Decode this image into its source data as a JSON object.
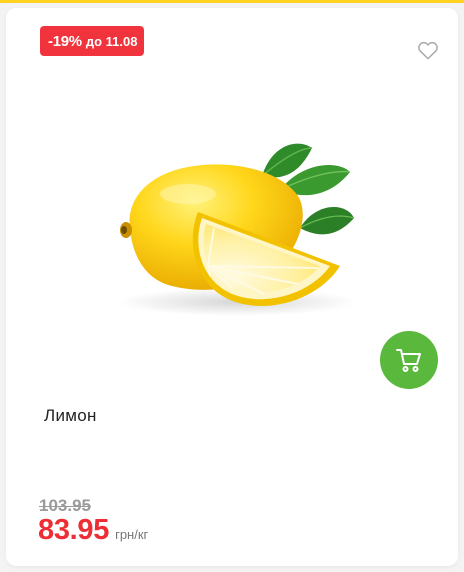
{
  "badge": {
    "discount": "-19%",
    "until": "до 11.08"
  },
  "favorite": {
    "icon": "heart-outline-icon"
  },
  "product": {
    "name": "Лимон",
    "image": "lemon-with-slice-and-leaves"
  },
  "cart": {
    "icon": "shopping-cart-icon",
    "color": "#5ab93c"
  },
  "price": {
    "old": "103.95",
    "current": "83.95",
    "unit": "грн/кг"
  },
  "colors": {
    "accent_red": "#ee2e35",
    "badge_red": "#f0333c",
    "top_line": "#ffd21f"
  }
}
